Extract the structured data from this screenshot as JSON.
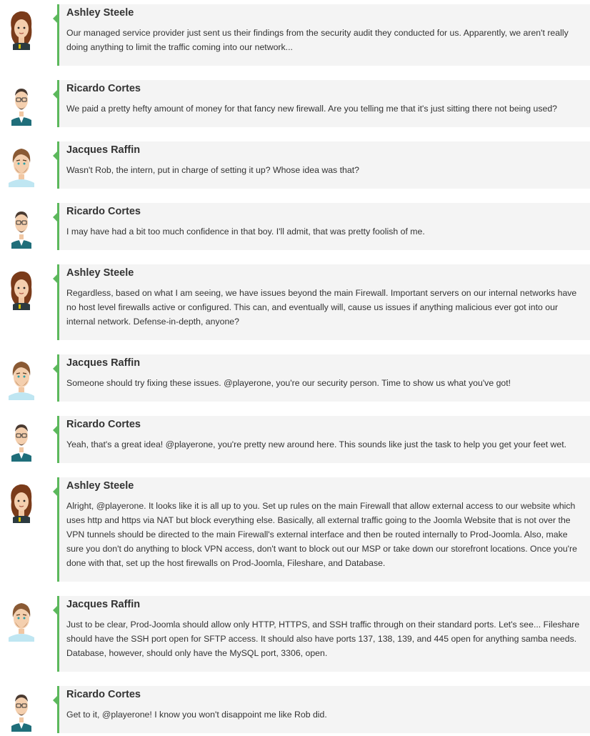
{
  "colors": {
    "accent": "#5cb85c",
    "bubble_bg": "#f4f4f4",
    "text": "#333333"
  },
  "messages": [
    {
      "name": "Ashley Steele",
      "avatar": "ashley-steele-avatar",
      "text": "Our managed service provider just sent us their findings from the security audit they conducted for us. Apparently, we aren't really doing anything to limit the traffic coming into our network..."
    },
    {
      "name": "Ricardo Cortes",
      "avatar": "ricardo-cortes-avatar",
      "text": "We paid a pretty hefty amount of money for that fancy new firewall. Are you telling me that it's just sitting there not being used?"
    },
    {
      "name": "Jacques Raffin",
      "avatar": "jacques-raffin-avatar",
      "text": "Wasn't Rob, the intern, put in charge of setting it up? Whose idea was that?"
    },
    {
      "name": "Ricardo Cortes",
      "avatar": "ricardo-cortes-avatar",
      "text": "I may have had a bit too much confidence in that boy. I'll admit, that was pretty foolish of me."
    },
    {
      "name": "Ashley Steele",
      "avatar": "ashley-steele-avatar",
      "text": "Regardless, based on what I am seeing, we have issues beyond the main Firewall. Important servers on our internal networks have no host level firewalls active or configured. This can, and eventually will, cause us issues if anything malicious ever got into our internal network. Defense-in-depth, anyone?"
    },
    {
      "name": "Jacques Raffin",
      "avatar": "jacques-raffin-avatar",
      "text": "Someone should try fixing these issues. @playerone, you're our security person. Time to show us what you've got!"
    },
    {
      "name": "Ricardo Cortes",
      "avatar": "ricardo-cortes-avatar",
      "text": "Yeah, that's a great idea! @playerone, you're pretty new around here. This sounds like just the task to help you get your feet wet."
    },
    {
      "name": "Ashley Steele",
      "avatar": "ashley-steele-avatar",
      "text": "Alright, @playerone. It looks like it is all up to you. Set up rules on the main Firewall that allow external access to our website which uses http and https via NAT but block everything else. Basically, all external traffic going to the Joomla Website that is not over the VPN tunnels should be directed to the main Firewall's external interface and then be routed internally to Prod-Joomla. Also, make sure you don't do anything to block VPN access, don't want to block out our MSP or take down our storefront locations. Once you're done with that, set up the host firewalls on Prod-Joomla, Fileshare, and Database."
    },
    {
      "name": "Jacques Raffin",
      "avatar": "jacques-raffin-avatar",
      "text": "Just to be clear, Prod-Joomla should allow only HTTP, HTTPS, and SSH traffic through on their standard ports. Let's see... Fileshare should have the SSH port open for SFTP access. It should also have ports 137, 138, 139, and 445 open for anything samba needs. Database, however, should only have the MySQL port, 3306, open."
    },
    {
      "name": "Ricardo Cortes",
      "avatar": "ricardo-cortes-avatar",
      "text": "Get to it, @playerone! I know you won't disappoint me like Rob did."
    }
  ]
}
